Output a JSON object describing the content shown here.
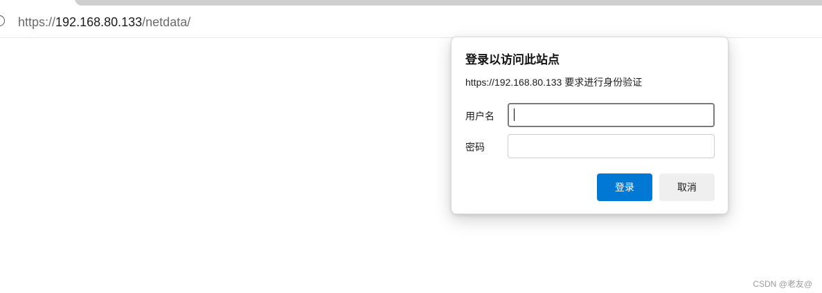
{
  "address_bar": {
    "scheme": "https://",
    "host": "192.168.80.133",
    "path": "/netdata/"
  },
  "dialog": {
    "title": "登录以访问此站点",
    "subtitle": "https://192.168.80.133 要求进行身份验证",
    "username_label": "用户名",
    "username_value": "",
    "password_label": "密码",
    "password_value": "",
    "login_button": "登录",
    "cancel_button": "取消"
  },
  "colors": {
    "primary_button": "#0078d4",
    "secondary_button": "#efefef"
  },
  "watermark": "CSDN @老友@"
}
